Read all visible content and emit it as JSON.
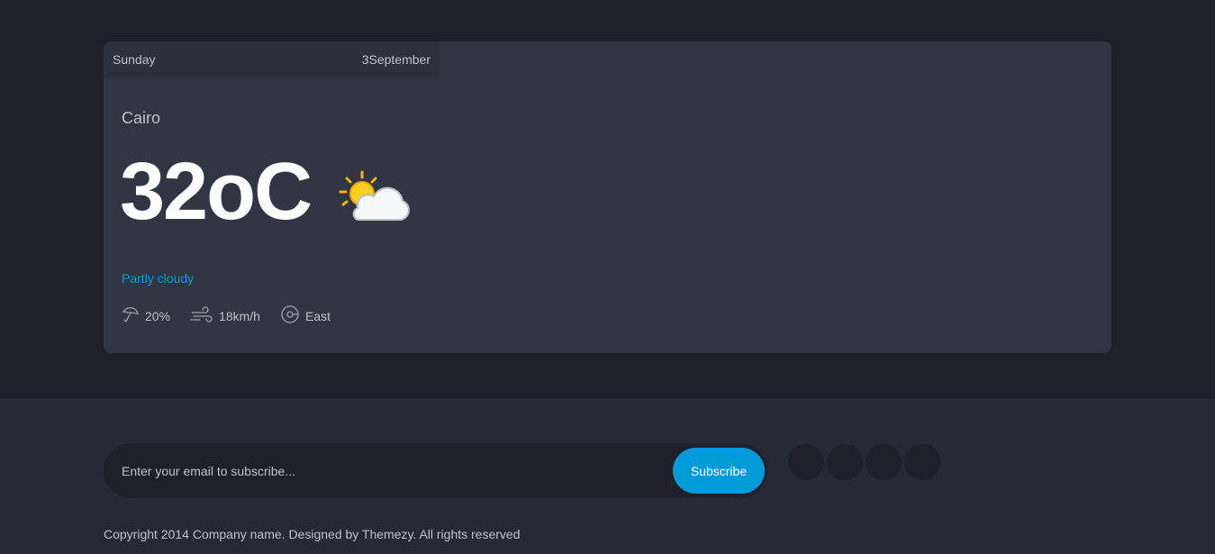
{
  "forecast": {
    "day": "Sunday",
    "date": "3September",
    "location": "Cairo",
    "temperature": "32",
    "unit": "oC",
    "condition": "Partly cloudy",
    "icon": "partly-cloudy-icon",
    "stats": {
      "precipitation": "20%",
      "wind_speed": "18km/h",
      "wind_direction": "East"
    }
  },
  "subscribe": {
    "placeholder": "Enter your email to subscribe...",
    "button_label": "Subscribe"
  },
  "social": {
    "icons": [
      "social-icon-1",
      "social-icon-2",
      "social-icon-3",
      "social-icon-4"
    ]
  },
  "footer": {
    "copyright": "Copyright 2014 Company name. Designed by Themezy. All rights reserved"
  },
  "colors": {
    "accent": "#009ad8",
    "card": "#323544",
    "background": "#1e202b",
    "footer": "#262936"
  }
}
